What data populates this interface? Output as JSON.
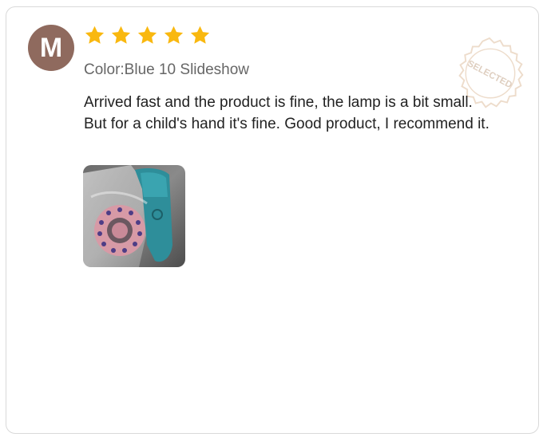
{
  "review": {
    "avatar_initial": "M",
    "rating": 5,
    "variant_label": "Color:Blue 10 Slideshow",
    "text": "Arrived fast and the product is fine, the lamp is a bit small. But for a child's hand it's fine. Good product, I recommend it.",
    "badge_text": "SELECTED"
  },
  "colors": {
    "avatar_bg": "#8f6a5e",
    "star": "#f9b80f",
    "seal": "#e6cdb4"
  },
  "icons": {
    "star": "star-icon",
    "badge": "selected-seal-icon"
  }
}
